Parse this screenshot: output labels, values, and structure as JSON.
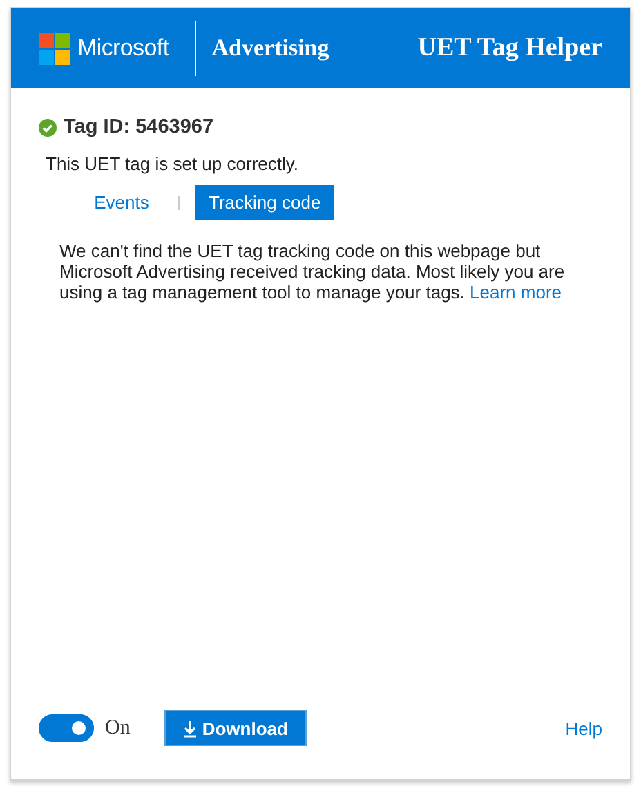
{
  "header": {
    "brand": "Microsoft",
    "product": "Advertising",
    "title": "UET Tag Helper"
  },
  "tag": {
    "ok": true,
    "id_label": "Tag ID: 5463967",
    "message": "This UET tag is set up correctly."
  },
  "tabs": [
    {
      "label": "Events",
      "selected": false
    },
    {
      "label": "Tracking code",
      "selected": true
    }
  ],
  "description": {
    "text": "We can't find the UET tag tracking code on this webpage but Microsoft Advertising received tracking data. Most likely you are using a tag management tool to manage your tags.",
    "link": "Learn more"
  },
  "footer": {
    "toggle": {
      "on": true,
      "label": "On"
    },
    "download": "Download",
    "help": "Help"
  }
}
